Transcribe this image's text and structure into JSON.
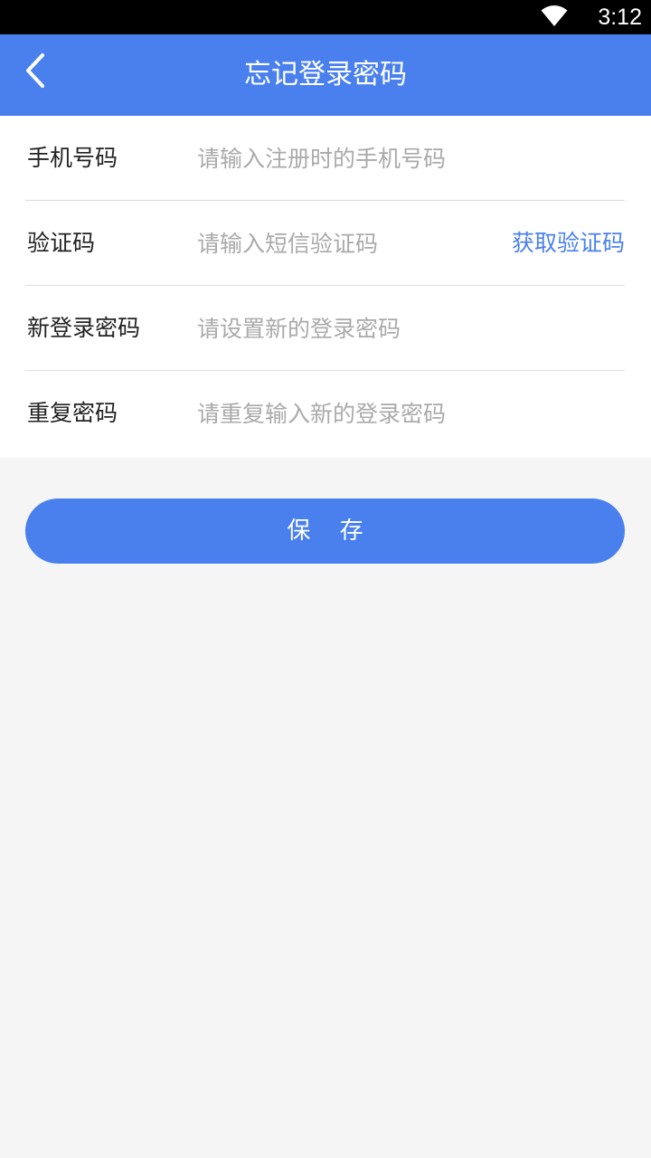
{
  "status_bar": {
    "time": "3:12",
    "icons": [
      "wifi-icon"
    ]
  },
  "header": {
    "title": "忘记登录密码",
    "back_icon": "back-arrow-icon"
  },
  "form": {
    "phone": {
      "label": "手机号码",
      "placeholder": "请输入注册时的手机号码"
    },
    "code": {
      "label": "验证码",
      "placeholder": "请输入短信验证码",
      "action_label": "获取验证码"
    },
    "new_password": {
      "label": "新登录密码",
      "placeholder": "请设置新的登录密码"
    },
    "repeat_password": {
      "label": "重复密码",
      "placeholder": "请重复输入新的登录密码"
    }
  },
  "save_button": {
    "label": "保 存"
  },
  "colors": {
    "primary": "#4a80ee",
    "background": "#f5f5f5",
    "placeholder": "#aaaaaa"
  }
}
